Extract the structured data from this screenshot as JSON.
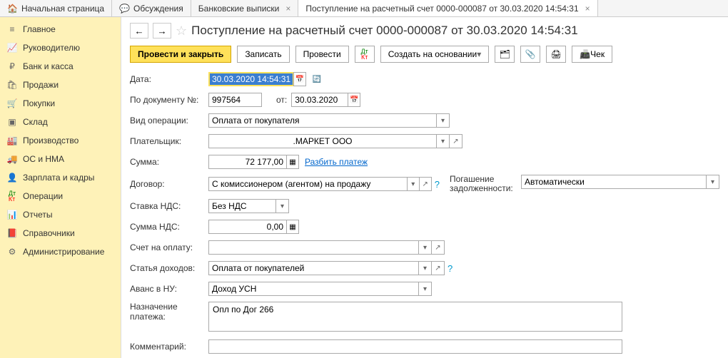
{
  "tabs": {
    "home": "Начальная страница",
    "discuss": "Обсуждения",
    "bank": "Банковские выписки",
    "doc": "Поступление на расчетный счет 0000-000087 от 30.03.2020 14:54:31"
  },
  "sidebar": {
    "main": "Главное",
    "manager": "Руководителю",
    "bank": "Банк и касса",
    "sales": "Продажи",
    "purchases": "Покупки",
    "warehouse": "Склад",
    "production": "Производство",
    "os": "ОС и НМА",
    "salary": "Зарплата и кадры",
    "operations": "Операции",
    "reports": "Отчеты",
    "refs": "Справочники",
    "admin": "Администрирование"
  },
  "title": "Поступление на расчетный счет 0000-000087 от 30.03.2020 14:54:31",
  "toolbar": {
    "post_close": "Провести и закрыть",
    "write": "Записать",
    "post": "Провести",
    "create_based": "Создать на основании",
    "check": "Чек"
  },
  "labels": {
    "date": "Дата:",
    "doc_num": "По документу №:",
    "from": "от:",
    "op_type": "Вид операции:",
    "payer": "Плательщик:",
    "amount": "Сумма:",
    "split": "Разбить платеж",
    "contract": "Договор:",
    "debt": "Погашение задолженности:",
    "vat_rate": "Ставка НДС:",
    "vat_sum": "Сумма НДС:",
    "invoice": "Счет на оплату:",
    "income": "Статья доходов:",
    "advance": "Аванс в НУ:",
    "purpose": "Назначение платежа:",
    "comment": "Комментарий:"
  },
  "values": {
    "date": "30.03.2020 14:54:31",
    "doc_num": "997564",
    "doc_date": "30.03.2020",
    "op_type": "Оплата от покупателя",
    "payer": ".МАРКЕТ ООО",
    "amount": "72 177,00",
    "contract": "С комиссионером (агентом) на продажу",
    "debt": "Автоматически",
    "vat_rate": "Без НДС",
    "vat_sum": "0,00",
    "invoice": "",
    "income": "Оплата от покупателей",
    "advance": "Доход УСН",
    "purpose": "Опл по Дог 266",
    "comment": ""
  }
}
